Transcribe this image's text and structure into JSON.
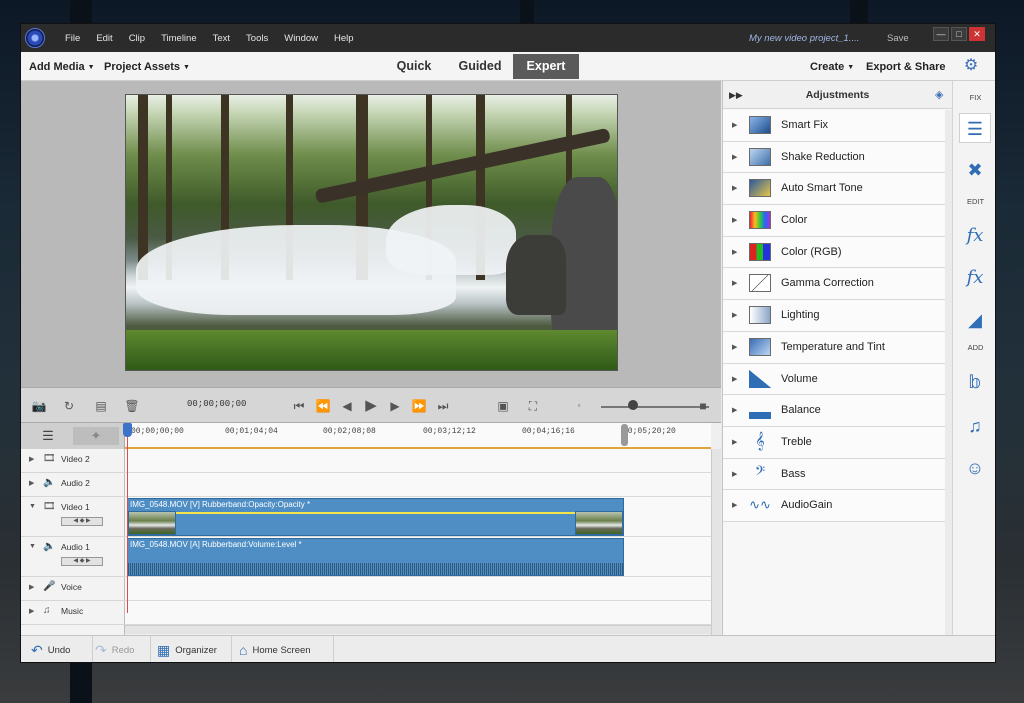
{
  "menu": {
    "items": [
      "File",
      "Edit",
      "Clip",
      "Timeline",
      "Text",
      "Tools",
      "Window",
      "Help"
    ],
    "project_title": "My new video project_1....",
    "save_label": "Save"
  },
  "toolbar": {
    "add_media": "Add Media",
    "project_assets": "Project Assets",
    "modes": [
      "Quick",
      "Guided",
      "Expert"
    ],
    "active_mode": "Expert",
    "create": "Create",
    "export_share": "Export & Share"
  },
  "transport": {
    "timecode": "00;00;00;00",
    "zoom_level": 0.3
  },
  "timeline": {
    "ruler_labels": [
      "00;00;00;00",
      "00;01;04;04",
      "00;02;08;08",
      "00;03;12;12",
      "00;04;16;16",
      "00;05;20;20"
    ],
    "ruler_start_label": "00;00;00;00",
    "tracks": [
      {
        "name": "Video 2",
        "type": "video"
      },
      {
        "name": "Audio 2",
        "type": "audio"
      },
      {
        "name": "Video 1",
        "type": "video"
      },
      {
        "name": "Audio 1",
        "type": "audio"
      },
      {
        "name": "Voice",
        "type": "voice"
      },
      {
        "name": "Music",
        "type": "music"
      }
    ],
    "video_clip_label": "IMG_0548.MOV [V] Rubberband:Opacity:Opacity *",
    "audio_clip_label": "IMG_0548.MOV [A] Rubberband:Volume:Level *"
  },
  "bottom": {
    "undo": "Undo",
    "redo": "Redo",
    "organizer": "Organizer",
    "home_screen": "Home Screen"
  },
  "adjustments": {
    "title": "Adjustments",
    "items": [
      {
        "label": "Smart Fix",
        "icon": "smart-fix-icon"
      },
      {
        "label": "Shake Reduction",
        "icon": "shake-reduction-icon"
      },
      {
        "label": "Auto Smart Tone",
        "icon": "auto-smart-tone-icon"
      },
      {
        "label": "Color",
        "icon": "color-icon"
      },
      {
        "label": "Color (RGB)",
        "icon": "color-rgb-icon"
      },
      {
        "label": "Gamma Correction",
        "icon": "gamma-correction-icon"
      },
      {
        "label": "Lighting",
        "icon": "lighting-icon"
      },
      {
        "label": "Temperature and Tint",
        "icon": "temperature-tint-icon"
      },
      {
        "label": "Volume",
        "icon": "volume-icon"
      },
      {
        "label": "Balance",
        "icon": "balance-icon"
      },
      {
        "label": "Treble",
        "icon": "treble-icon"
      },
      {
        "label": "Bass",
        "icon": "bass-icon"
      },
      {
        "label": "AudioGain",
        "icon": "audiogain-icon"
      }
    ]
  },
  "side_tools": {
    "fix_label": "FIX",
    "edit_label": "EDIT",
    "add_label": "ADD"
  },
  "colors": {
    "accent": "#2f6db5",
    "clip_blue": "#4f8ec4",
    "playhead": "#e24a4a",
    "active_tab_bg": "#5a5a5a"
  }
}
